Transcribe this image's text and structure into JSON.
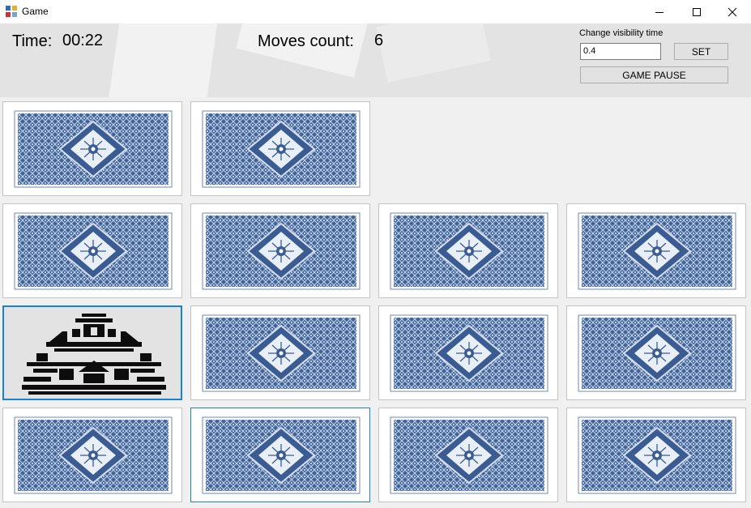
{
  "window": {
    "title": "Game",
    "icon": "app-icon",
    "controls": [
      "minimize-icon",
      "maximize-icon",
      "close-icon"
    ]
  },
  "hud": {
    "time_label": "Time:",
    "time_value": "00:22",
    "moves_label": "Moves count:",
    "moves_value": "6",
    "visibility_label": "Change visibility time",
    "visibility_value": "0.4",
    "set_button": "SET",
    "pause_button": "GAME PAUSE"
  },
  "board": {
    "rows": [
      [
        {
          "state": "back"
        },
        {
          "state": "back"
        },
        {
          "state": "empty"
        },
        {
          "state": "empty"
        }
      ],
      [
        {
          "state": "back"
        },
        {
          "state": "back"
        },
        {
          "state": "back"
        },
        {
          "state": "back"
        }
      ],
      [
        {
          "state": "face",
          "image": "castle",
          "selected": true
        },
        {
          "state": "back"
        },
        {
          "state": "back"
        },
        {
          "state": "back"
        }
      ],
      [
        {
          "state": "back"
        },
        {
          "state": "back",
          "focused": true
        },
        {
          "state": "back"
        },
        {
          "state": "back"
        }
      ]
    ]
  },
  "colors": {
    "card_back": "#3d5f93",
    "card_back_light": "#d9e2ef",
    "selection": "#1a80d0",
    "hud_bg": "#e3e3e3"
  }
}
